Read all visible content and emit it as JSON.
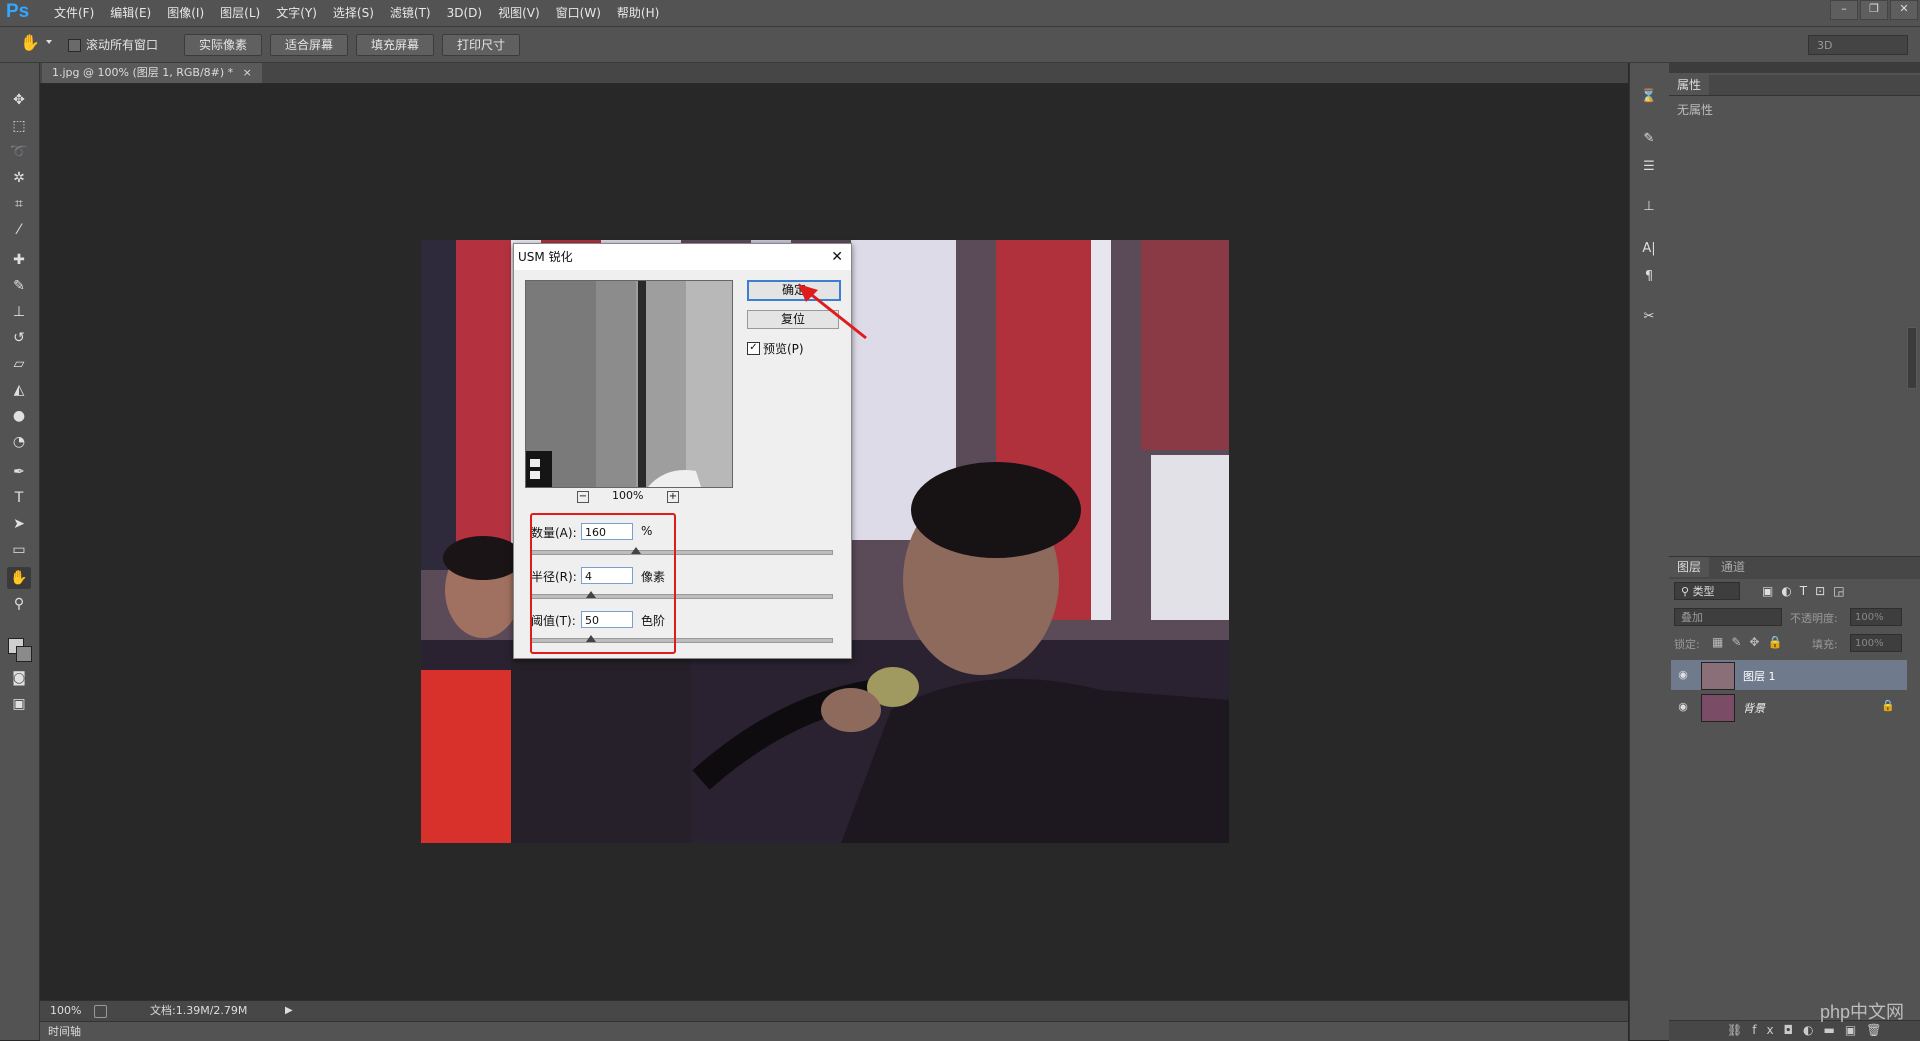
{
  "app": {
    "logo": "Ps"
  },
  "menu": [
    "文件(F)",
    "编辑(E)",
    "图像(I)",
    "图层(L)",
    "文字(Y)",
    "选择(S)",
    "滤镜(T)",
    "3D(D)",
    "视图(V)",
    "窗口(W)",
    "帮助(H)"
  ],
  "window_controls": [
    "–",
    "❐",
    "✕"
  ],
  "options": {
    "scroll_all_label": "滚动所有窗口",
    "buttons": [
      "实际像素",
      "适合屏幕",
      "填充屏幕",
      "打印尺寸"
    ],
    "workspace": "3D"
  },
  "document": {
    "tab_title": "1.jpg @ 100% (图层 1, RGB/8#) *",
    "tab_close": "×"
  },
  "status": {
    "zoom": "100%",
    "doc_size": "文档:1.39M/2.79M",
    "timeline": "时间轴"
  },
  "dialog": {
    "title": "USM 锐化",
    "close": "✕",
    "ok": "确定",
    "reset": "复位",
    "preview_label": "预览(P)",
    "preview_checked": true,
    "preview_zoom": "100%",
    "amount_label": "数量(A):",
    "amount_value": "160",
    "amount_unit": "%",
    "amount_fraction": 0.35,
    "radius_label": "半径(R):",
    "radius_value": "4",
    "radius_unit": "像素",
    "radius_fraction": 0.2,
    "threshold_label": "阈值(T):",
    "threshold_value": "50",
    "threshold_unit": "色阶",
    "threshold_fraction": 0.2
  },
  "panels": {
    "properties_tab": "属性",
    "properties_empty": "无属性",
    "layers_tab": "图层",
    "channels_tab": "通道",
    "filter_kind": "类型",
    "blend_mode": "叠加",
    "opacity_label": "不透明度:",
    "opacity_value": "100%",
    "lock_label": "锁定:",
    "fill_label": "填充:",
    "fill_value": "100%",
    "layers": [
      {
        "name": "图层 1",
        "selected": true,
        "locked": false
      },
      {
        "name": "背景",
        "selected": false,
        "locked": true
      }
    ]
  },
  "watermark": "php中文网",
  "colors": {
    "accent": "#31a8ff",
    "annotation": "#e01b1b",
    "selected_layer": "#6f7a8c"
  }
}
